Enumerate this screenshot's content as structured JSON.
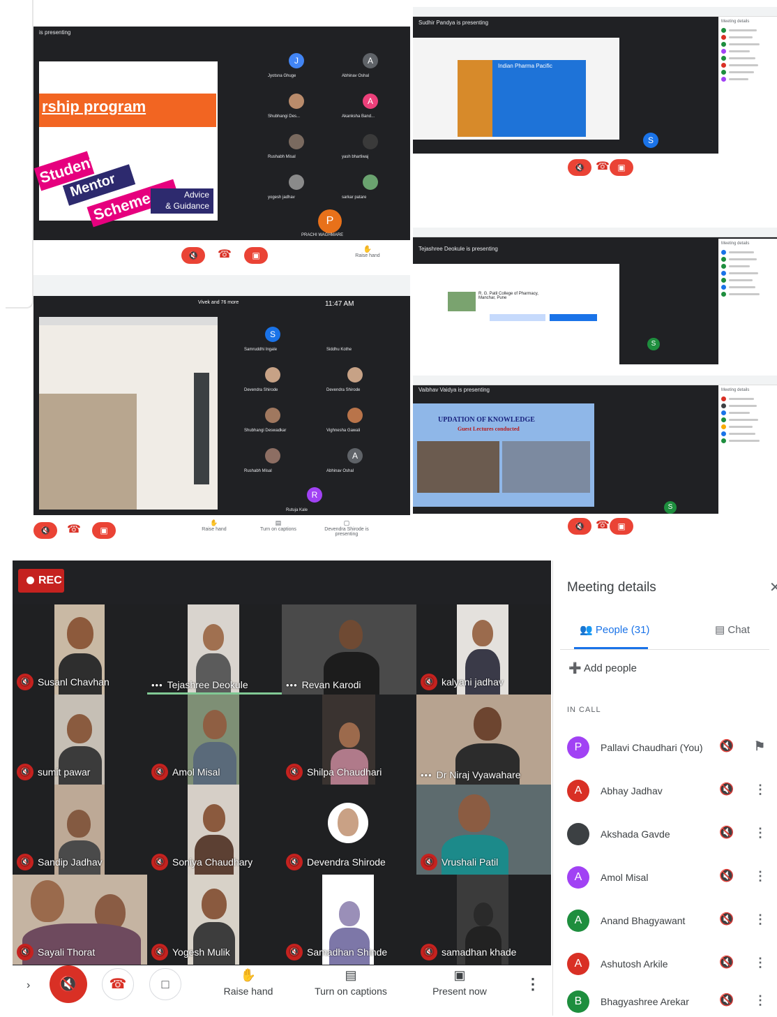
{
  "collage": {
    "shot1": {
      "label": "is presenting",
      "slide_banner": "rship program",
      "slide_word1": "Student",
      "slide_word2": "Mentor",
      "slide_word3": "Scheme",
      "slide_word4": "Advice",
      "slide_word5": "& Guidance",
      "big_avatar": "P",
      "avatar_j": "J",
      "avatar_a1": "A",
      "avatar_a2": "A",
      "raise_label": "Raise hand",
      "names": [
        "Jyotsna Ghuge",
        "Abhinav Oshal",
        "Shubhangi Des...",
        "Akanksha Band...",
        "Rushabh Misal",
        "yash bhartiwaj",
        "yogesh jadhav",
        "sarkar patare",
        "PRACHI WAGHMARE"
      ]
    },
    "shot2": {
      "label": "Sudhir Pandya is presenting",
      "slide_title": "Indian Pharma Pacific",
      "avatar_s": "S",
      "panel_title": "Meeting details"
    },
    "shot3": {
      "time": "11:47 AM",
      "header": "Vivek and 76 more",
      "avatar_s": "S",
      "avatar_a": "A",
      "avatar_r": "R",
      "names": [
        "Samruddhi Ingale",
        "Siddhu Kothe",
        "Devendra Shirode",
        "Devendra Shirode",
        "Shubhangi Deswadkar",
        "Vighnesha Gawali",
        "Rushabh Misal",
        "Abhinav Oshal",
        "Rutuja Kale"
      ],
      "ctrl_raise": "Raise hand",
      "ctrl_captions": "Turn on captions",
      "ctrl_present": "Devendra Shirode is presenting"
    },
    "shot4": {
      "label": "Tejashree Deokule is presenting",
      "slide_title": "R. G. Patil College of Pharmacy, Manchar, Pune",
      "avatar_s": "S",
      "panel_title": "Meeting details"
    },
    "shot5": {
      "label": "Vaibhav Vaidya is presenting",
      "slide_title": "UPDATION OF KNOWLEDGE",
      "slide_sub": "Guest Lectures conducted",
      "avatar_s": "S",
      "panel_title": "Meeting details"
    }
  },
  "meet": {
    "rec_label": "REC",
    "tiles": [
      {
        "name": "Susanl Chavhan",
        "speaking": false
      },
      {
        "name": "Tejashree Deokule",
        "speaking": true
      },
      {
        "name": "Revan Karodi",
        "speaking": true
      },
      {
        "name": "kalyani jadhav",
        "speaking": false
      },
      {
        "name": "sumit pawar",
        "speaking": false
      },
      {
        "name": "Amol Misal",
        "speaking": false
      },
      {
        "name": "Shilpa Chaudhari",
        "speaking": false
      },
      {
        "name": "Dr Niraj Vyawahare",
        "speaking": true
      },
      {
        "name": "Sandip Jadhav",
        "speaking": false
      },
      {
        "name": "Soniya Chaudhary",
        "speaking": false
      },
      {
        "name": "Devendra Shirode",
        "speaking": false
      },
      {
        "name": "Vrushali Patil",
        "speaking": false
      },
      {
        "name": "Sayali Thorat",
        "speaking": false
      },
      {
        "name": "Yogesh Mulik",
        "speaking": false
      },
      {
        "name": "Samadhan Shinde",
        "speaking": false
      },
      {
        "name": "samadhan khade",
        "speaking": false
      }
    ],
    "controls": {
      "raise_hand": "Raise hand",
      "captions": "Turn on captions",
      "present": "Present now"
    }
  },
  "panel": {
    "title": "Meeting details",
    "tab_people": "People (31)",
    "tab_chat": "Chat",
    "add_people": "Add people",
    "in_call": "IN CALL",
    "people": [
      {
        "initial": "P",
        "name": "Pallavi Chaudhari (You)",
        "color": "#a142f4"
      },
      {
        "initial": "A",
        "name": "Abhay Jadhav",
        "color": "#d93025"
      },
      {
        "initial": "",
        "name": "Akshada Gavde",
        "color": "#3c4043"
      },
      {
        "initial": "A",
        "name": "Amol Misal",
        "color": "#a142f4"
      },
      {
        "initial": "A",
        "name": "Anand Bhagyawant",
        "color": "#1e8e3e"
      },
      {
        "initial": "A",
        "name": "Ashutosh Arkile",
        "color": "#d93025"
      },
      {
        "initial": "B",
        "name": "Bhagyashree Arekar",
        "color": "#1e8e3e"
      }
    ]
  },
  "colors": {
    "meet_bg": "#202124",
    "mic_off": "#c5221f",
    "accent": "#1a73e8",
    "speaking": "#81c995"
  }
}
